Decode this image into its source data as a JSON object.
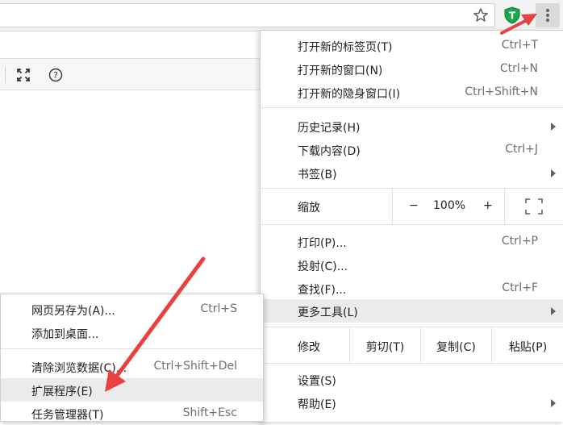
{
  "colors": {
    "annotation_arrow": "#e8413f",
    "menu_highlight": "#ebebeb",
    "extension_shield": "#1aa84c"
  },
  "icons": {
    "star": "bookmark-star-icon",
    "extension": "shield-extension-icon",
    "extension_letter": "T",
    "menu": "kebab-menu-icon",
    "fullscreen": "fullscreen-icon",
    "help": "help-icon",
    "help_glyph": "?"
  },
  "main_menu": {
    "new_tab": {
      "label": "打开新的标签页(T)",
      "shortcut": "Ctrl+T"
    },
    "new_window": {
      "label": "打开新的窗口(N)",
      "shortcut": "Ctrl+N"
    },
    "incognito": {
      "label": "打开新的隐身窗口(I)",
      "shortcut": "Ctrl+Shift+N"
    },
    "history": {
      "label": "历史记录(H)"
    },
    "downloads": {
      "label": "下载内容(D)",
      "shortcut": "Ctrl+J"
    },
    "bookmarks": {
      "label": "书签(B)"
    },
    "zoom": {
      "label": "缩放",
      "minus": "−",
      "value": "100%",
      "plus": "+"
    },
    "print": {
      "label": "打印(P)...",
      "shortcut": "Ctrl+P"
    },
    "cast": {
      "label": "投射(C)..."
    },
    "find": {
      "label": "查找(F)...",
      "shortcut": "Ctrl+F"
    },
    "more_tools": {
      "label": "更多工具(L)"
    },
    "edit": {
      "label": "修改",
      "cut": "剪切(T)",
      "copy": "复制(C)",
      "paste": "粘贴(P)"
    },
    "settings": {
      "label": "设置(S)"
    },
    "help": {
      "label": "帮助(E)"
    }
  },
  "sub_menu": {
    "save_page": {
      "label": "网页另存为(A)...",
      "shortcut": "Ctrl+S"
    },
    "add_desktop": {
      "label": "添加到桌面..."
    },
    "clear_data": {
      "label": "清除浏览数据(C)...",
      "shortcut": "Ctrl+Shift+Del"
    },
    "extensions": {
      "label": "扩展程序(E)"
    },
    "task_manager": {
      "label": "任务管理器(T)",
      "shortcut": "Shift+Esc"
    }
  }
}
